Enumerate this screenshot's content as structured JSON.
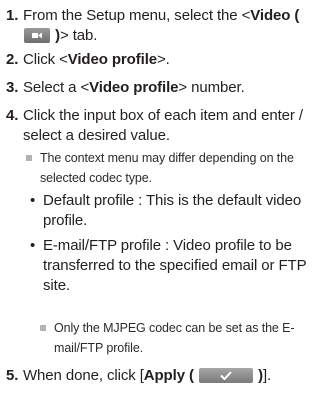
{
  "step1": {
    "num": "1.",
    "pre": "From the Setup menu, select the <",
    "bold_pre": "Video (",
    "icon": "video-tab-icon",
    "bold_post": ")",
    "post": "> tab."
  },
  "step2": {
    "num": "2.",
    "pre": "Click <",
    "bold": "Video profile",
    "post": ">."
  },
  "step3": {
    "num": "3.",
    "pre": "Select a <",
    "bold": "Video profile",
    "post": "> number."
  },
  "step4": {
    "num": "4.",
    "text": "Click the input box of each item and enter / select a desired value.",
    "note": "The context menu may differ depending on the selected codec type.",
    "bullet1": "Default profile : This is the default video profile.",
    "bullet2": "E-mail/FTP profile : Video profile to be transferred to the specified email or FTP site.",
    "note2": "Only the MJPEG codec can be set as the E-mail/FTP profile.",
    "bullet_char": "•"
  },
  "step5": {
    "num": "5.",
    "pre": "When done, click [",
    "bold_pre": "Apply (",
    "icon": "apply-check-icon",
    "bold_post": ")",
    "post": "]."
  }
}
